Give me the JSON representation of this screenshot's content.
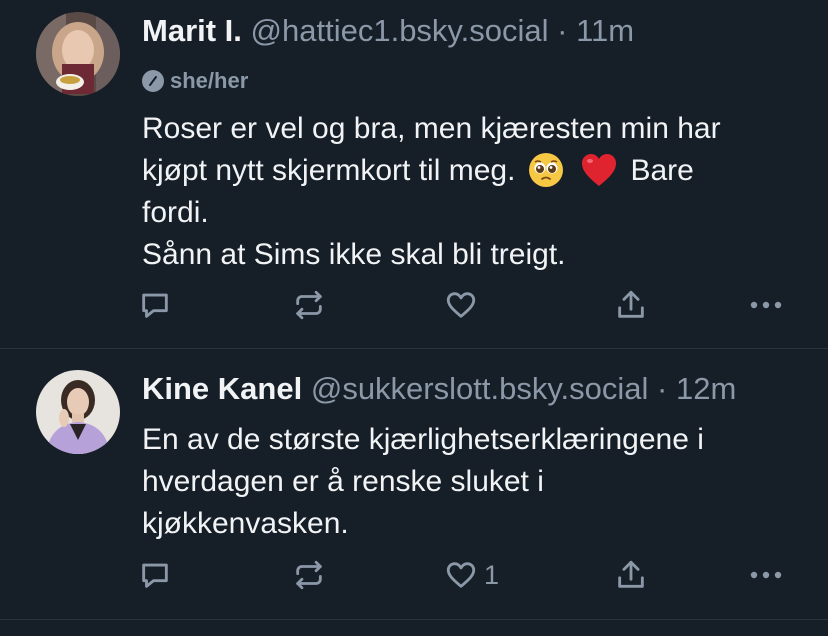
{
  "posts": [
    {
      "author_name": "Marit I.",
      "handle": "@hattiec1.bsky.social",
      "separator": "·",
      "time": "11m",
      "pronouns": "she/her",
      "body": {
        "line1": "Roser er vel og bra, men kjæresten min har",
        "line2_start": "kjøpt nytt skjermkort til meg.",
        "line2_end": "Bare",
        "line3": "fordi.",
        "line4": "Sånn at Sims ikke skal bli treigt."
      },
      "emojis": [
        "pleading-face-emoji",
        "red-heart-emoji"
      ],
      "like_count": ""
    },
    {
      "author_name": "Kine Kanel",
      "handle": "@sukkerslott.bsky.social",
      "separator": "·",
      "time": "12m",
      "body": {
        "line1": "En av de største kjærlighetserklæringene i",
        "line2": "hverdagen er å renske sluket i",
        "line3": "kjøkkenvasken."
      },
      "like_count": "1"
    }
  ],
  "icons": [
    "reply-icon",
    "repost-icon",
    "like-icon",
    "share-icon",
    "more-icon"
  ],
  "colors": {
    "background": "#161e27",
    "text": "#f1f3f5",
    "muted": "#8b98a8",
    "divider": "#2a3340"
  }
}
